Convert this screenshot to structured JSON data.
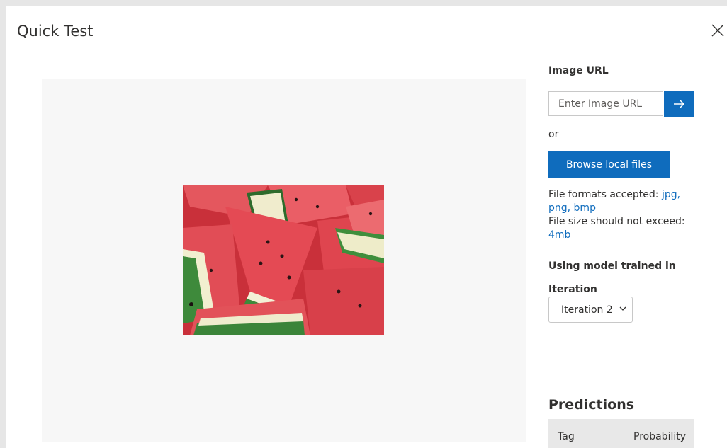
{
  "dialog": {
    "title": "Quick Test",
    "close_icon": "close-icon"
  },
  "image_url": {
    "label": "Image URL",
    "placeholder": "Enter Image URL",
    "value": "",
    "submit_icon": "arrow-right-icon"
  },
  "or_text": "or",
  "browse_button": "Browse local files",
  "file_info": {
    "formats_label": "File formats accepted:",
    "formats": "jpg, png, bmp",
    "size_label": "File size should not exceed:",
    "size": "4mb"
  },
  "model_label": "Using model trained in",
  "iteration": {
    "label": "Iteration",
    "selected": "Iteration 2"
  },
  "predictions": {
    "title": "Predictions",
    "columns": [
      "Tag",
      "Probability"
    ]
  },
  "colors": {
    "accent": "#0f6cbd",
    "preview_bg": "#f7f7f7",
    "watermelon_flesh": "#e0414a",
    "watermelon_rind": "#3f8a3a"
  }
}
